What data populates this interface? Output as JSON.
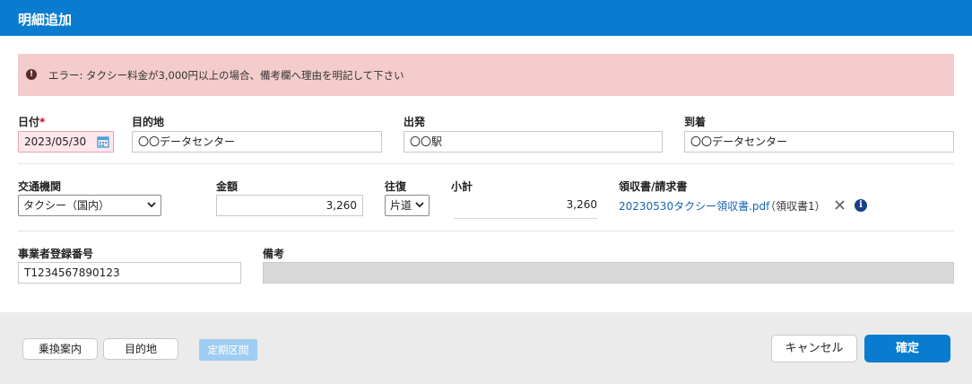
{
  "dialog": {
    "title": "明細追加"
  },
  "alert": {
    "text": "エラー: タクシー料金が3,000円以上の場合、備考欄へ理由を明記して下さい"
  },
  "row1": {
    "date": {
      "label": "日付",
      "required_mark": "*",
      "value": "2023/05/30"
    },
    "destination": {
      "label": "目的地",
      "value": "〇〇データセンター"
    },
    "departure": {
      "label": "出発",
      "value": "〇〇駅"
    },
    "arrival": {
      "label": "到着",
      "value": "〇〇データセンター"
    }
  },
  "row2": {
    "transport": {
      "label": "交通機関",
      "selected": "タクシー（国内）"
    },
    "amount": {
      "label": "金額",
      "value": "3,260"
    },
    "round_trip": {
      "label": "往復",
      "selected": "片道"
    },
    "subtotal": {
      "label": "小計",
      "value": "3,260"
    },
    "receipt": {
      "label": "領収書/請求書",
      "file": "20230530タクシー領収書.pdf",
      "note": "（領収書1）"
    }
  },
  "row3": {
    "business_number": {
      "label": "事業者登録番号",
      "value": "T1234567890123"
    },
    "remarks": {
      "label": "備考",
      "value": ""
    }
  },
  "footer": {
    "route_button": "乗換案内",
    "destination_button": "目的地",
    "commuter_tag": "定期区間",
    "cancel_button": "キャンセル",
    "confirm_button": "確定"
  },
  "colors": {
    "header": "#0a7cd0",
    "alert_bg": "#f5cccc",
    "link": "#1565b5",
    "required": "#d0021b"
  }
}
